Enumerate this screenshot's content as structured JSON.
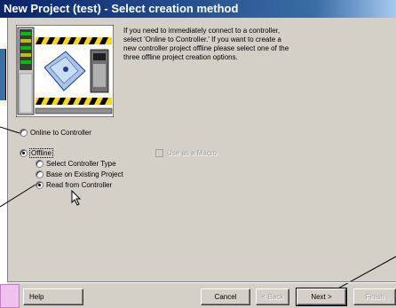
{
  "window": {
    "title": "New Project (test) - Select creation method"
  },
  "intro_text": "If you need to immediately connect to a controller,\nselect 'Online to Controller.' If you want to create a\nnew controller project offline please select one of the\nthree offline project creation options.",
  "options": {
    "online": {
      "label": "Online to Controller",
      "selected": false
    },
    "offline": {
      "label": "Offline",
      "selected": true,
      "sub": [
        {
          "label": "Select Controller Type",
          "selected": false
        },
        {
          "label": "Base on Existing Project",
          "selected": false
        },
        {
          "label": "Read from Controller",
          "selected": true
        }
      ]
    },
    "macro": {
      "label": "Use as a Macro",
      "checked": false,
      "enabled": false
    }
  },
  "buttons": {
    "help": "Help",
    "cancel": "Cancel",
    "back": "< Back",
    "next": "Next >",
    "finish": "Finish"
  },
  "icons": [
    "controller-illustration",
    "mouse-cursor-icon"
  ],
  "colors": {
    "titlebar": "#0a246a",
    "dialog": "#d4d0c8",
    "annotation": "#f0c0f0"
  }
}
